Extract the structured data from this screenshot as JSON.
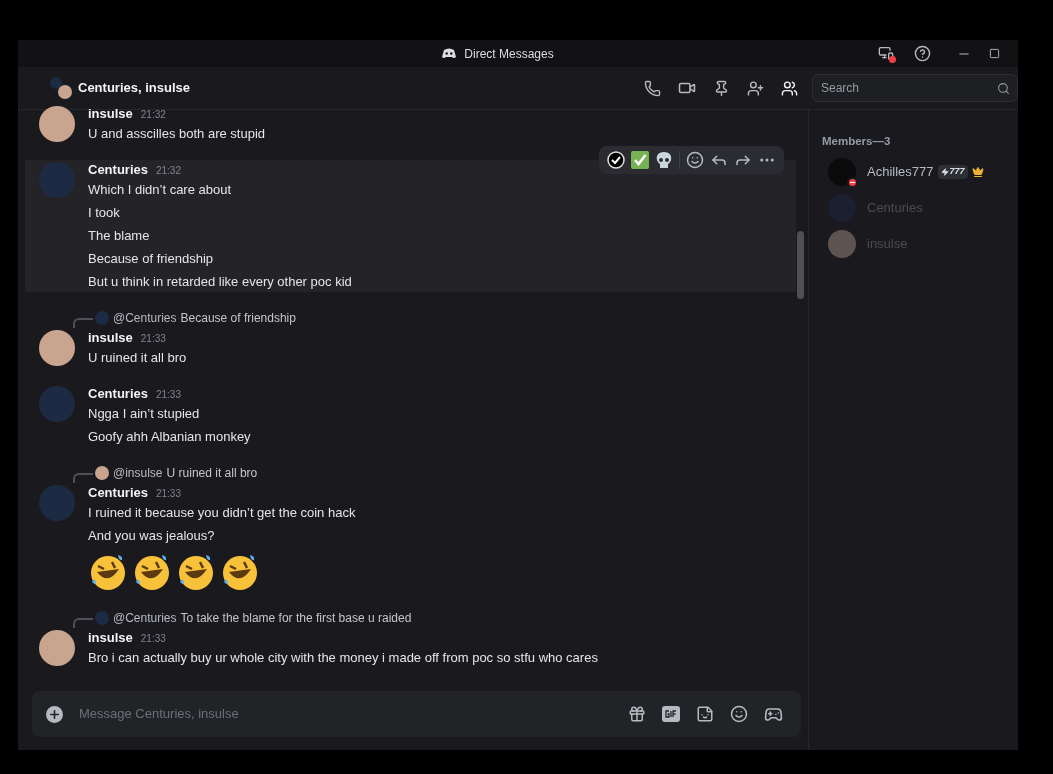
{
  "window": {
    "title": "Direct Messages"
  },
  "header": {
    "title": "Centuries, insulse",
    "search": {
      "placeholder": "Search"
    }
  },
  "messages": [
    {
      "author": "insulse",
      "color": "#c9a48f",
      "time": "21:32",
      "highlighted": false,
      "lines": [
        {
          "kind": "text",
          "text": "U and asscilles both are stupid"
        }
      ]
    },
    {
      "author": "Centuries",
      "color": "#1c2a44",
      "time": "21:32",
      "highlighted": true,
      "lines": [
        {
          "kind": "text",
          "text": "Which I didn’t care about"
        },
        {
          "kind": "text",
          "text": "I took"
        },
        {
          "kind": "text",
          "text": "The blame"
        },
        {
          "kind": "text",
          "text": "Because of friendship"
        },
        {
          "kind": "text",
          "text": "But u think in retarded like every other poc kid"
        }
      ]
    },
    {
      "author": "insulse",
      "color": "#c9a48f",
      "time": "21:33",
      "highlighted": false,
      "reply": {
        "color": "#1c2a44",
        "mention": "@Centuries",
        "text": "Because of friendship"
      },
      "lines": [
        {
          "kind": "text",
          "text": "U ruined it all bro"
        }
      ]
    },
    {
      "author": "Centuries",
      "color": "#1c2a44",
      "time": "21:33",
      "highlighted": false,
      "lines": [
        {
          "kind": "text",
          "text": "Ngga I ain’t stupied"
        },
        {
          "kind": "text",
          "text": "Goofy ahh Albanian monkey"
        }
      ]
    },
    {
      "author": "Centuries",
      "color": "#1c2a44",
      "time": "21:33",
      "highlighted": false,
      "reply": {
        "color": "#c9a48f",
        "mention": "@insulse",
        "text": "U ruined it all bro"
      },
      "lines": [
        {
          "kind": "text",
          "text": "I ruined it because you didn’t get the coin hack"
        },
        {
          "kind": "text",
          "text": "And you was jealous?"
        },
        {
          "kind": "emoji_row"
        }
      ]
    },
    {
      "author": "insulse",
      "color": "#c9a48f",
      "time": "21:33",
      "highlighted": false,
      "reply": {
        "color": "#1c2a44",
        "mention": "@Centuries",
        "text": "To take the blame for the first base u raided"
      },
      "lines": [
        {
          "kind": "text",
          "text": "Bro i can actually buy ur whole city with the money i made off from poc so stfu who cares"
        }
      ]
    }
  ],
  "composer": {
    "placeholder": "Message Centuries, insulse"
  },
  "members": {
    "heading": "Members—3",
    "items": [
      {
        "name": "Achilles777",
        "color": "#0b0b0b",
        "offline": false,
        "do_not_disturb": true,
        "tag": "777",
        "owner": true
      },
      {
        "name": "Centuries",
        "color": "#1b2030",
        "offline": true,
        "do_not_disturb": false,
        "owner": false
      },
      {
        "name": "insulse",
        "color": "#5f5350",
        "offline": true,
        "do_not_disturb": false,
        "owner": false
      }
    ]
  }
}
